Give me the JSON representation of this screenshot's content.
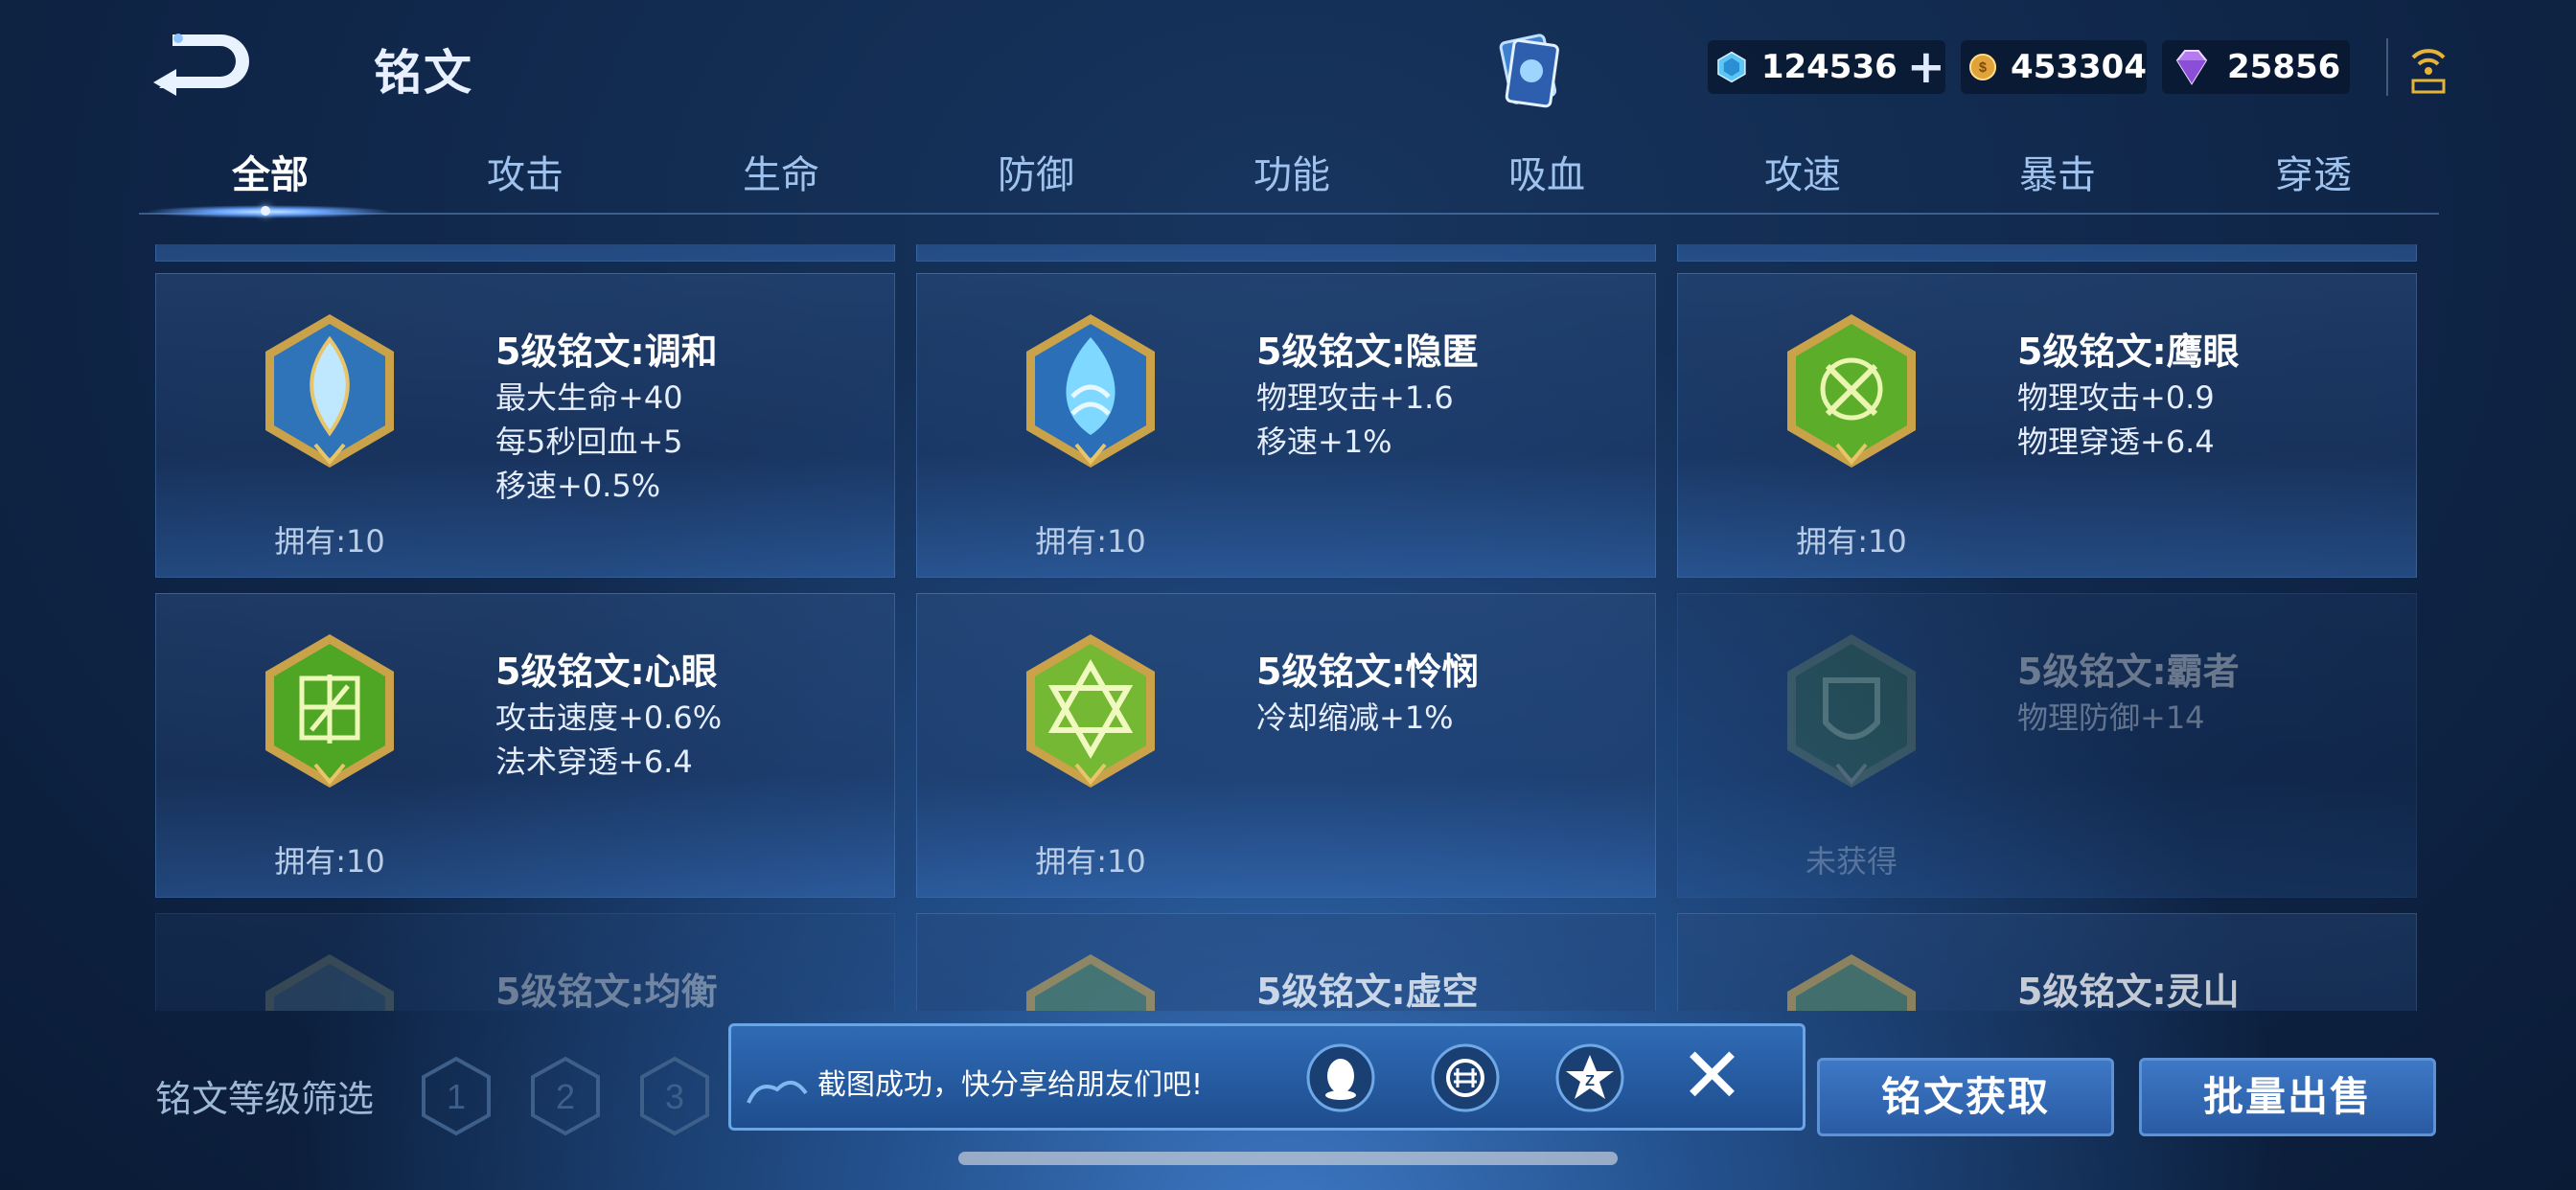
{
  "header": {
    "title": "铭文",
    "currencies": [
      {
        "icon": "blue-gem-icon",
        "amount": "124536"
      },
      {
        "icon": "gold-coin-icon",
        "amount": "453304"
      },
      {
        "icon": "purple-diamond-icon",
        "amount": "25856"
      }
    ]
  },
  "tabs": [
    "全部",
    "攻击",
    "生命",
    "防御",
    "功能",
    "吸血",
    "攻速",
    "暴击",
    "穿透"
  ],
  "active_tab": "全部",
  "inscriptions": [
    {
      "name": "5级铭文:调和",
      "stats": [
        "最大生命+40",
        "每5秒回血+5",
        "移速+0.5%"
      ],
      "owned": "拥有:10",
      "color": "#4ea0e0"
    },
    {
      "name": "5级铭文:隐匿",
      "stats": [
        "物理攻击+1.6",
        "移速+1%"
      ],
      "owned": "拥有:10",
      "color": "#3f8fdc"
    },
    {
      "name": "5级铭文:鹰眼",
      "stats": [
        "物理攻击+0.9",
        "物理穿透+6.4"
      ],
      "owned": "拥有:10",
      "color": "#6fbf2e"
    },
    {
      "name": "5级铭文:心眼",
      "stats": [
        "攻击速度+0.6%",
        "法术穿透+6.4"
      ],
      "owned": "拥有:10",
      "color": "#5fb02a"
    },
    {
      "name": "5级铭文:怜悯",
      "stats": [
        "冷却缩减+1%"
      ],
      "owned": "拥有:10",
      "color": "#7cc23a"
    },
    {
      "name": "5级铭文:霸者",
      "stats": [
        "物理防御+14"
      ],
      "owned": "未获得",
      "color": "#4e8a52"
    },
    {
      "name": "5级铭文:均衡",
      "stats": [],
      "owned": "",
      "color": "#4a6f8a"
    },
    {
      "name": "5级铭文:虚空",
      "stats": [],
      "owned": "",
      "color": "#4a6f8a"
    },
    {
      "name": "5级铭文:灵山",
      "stats": [],
      "owned": "",
      "color": "#4a6f8a"
    }
  ],
  "bottom": {
    "filter_label": "铭文等级筛选",
    "levels": [
      "1",
      "2",
      "3"
    ],
    "toast_message": "截图成功，快分享给朋友们吧!",
    "get_button": "铭文获取",
    "sell_button": "批量出售"
  }
}
